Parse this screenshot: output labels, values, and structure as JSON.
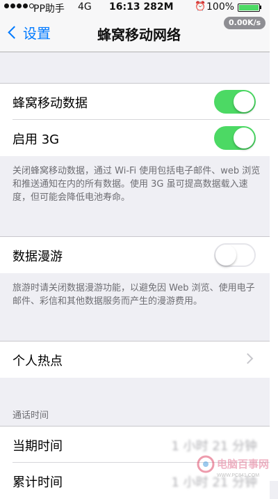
{
  "status_bar": {
    "carrier": "PP助手",
    "network": "4G",
    "time_memory": "16:13 282M",
    "battery": "100%",
    "alarm_icon": "alarm-clock-icon"
  },
  "nav": {
    "back_label": "设置",
    "title": "蜂窝移动网络",
    "speed": "0.00K/s"
  },
  "cellular_data": {
    "label": "蜂窝移动数据",
    "enabled": true
  },
  "enable_3g": {
    "label": "启用 3G",
    "enabled": true
  },
  "cellular_footer": "关闭蜂窝移动数据，通过 Wi-Fi 使用包括电子邮件、web 浏览和推送通知在内的所有数据。使用 3G 虽可提高数据载入速度，但可能会降低电池寿命。",
  "roaming": {
    "label": "数据漫游",
    "enabled": false
  },
  "roaming_footer": "旅游时请关闭数据漫游功能，以避免因 Web 浏览、使用电子邮件、彩信和其他数据服务而产生的漫游费用。",
  "hotspot": {
    "label": "个人热点"
  },
  "call_time": {
    "header": "通话时间",
    "current_label": "当期时间",
    "current_value": "1 小时 21 分钟",
    "total_label": "累计时间",
    "total_value": "1 小时 21 分钟"
  },
  "watermark": {
    "text": "电脑百事网",
    "url": "WWW.PC841.COM"
  },
  "colors": {
    "accent": "#007aff",
    "toggle_on": "#4cd964",
    "background": "#efeff4"
  }
}
